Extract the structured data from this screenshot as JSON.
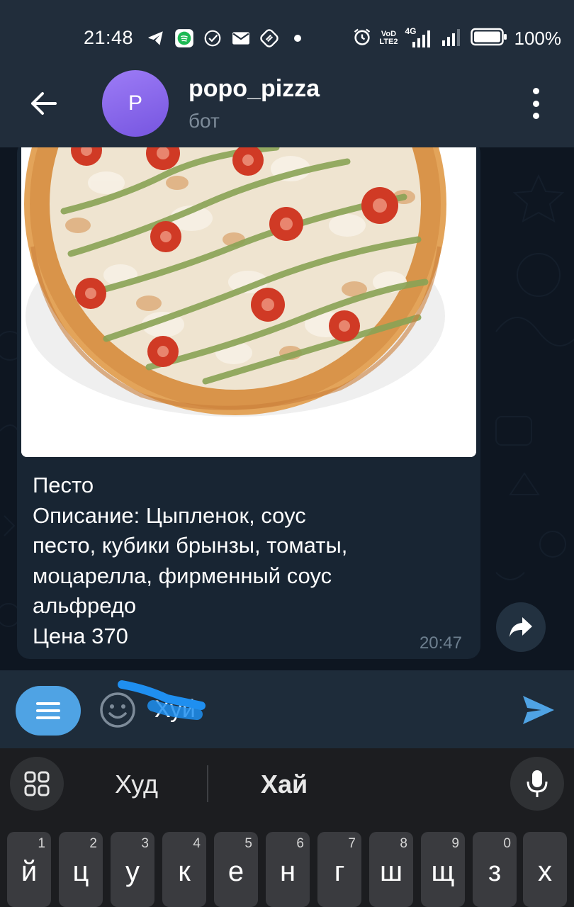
{
  "status_bar": {
    "time": "21:48",
    "net_label_top": "VoD",
    "net_label_bottom": "LTE2",
    "network_type": "4G",
    "battery": "100%"
  },
  "header": {
    "avatar_letter": "P",
    "title": "popo_pizza",
    "subtitle": "бот"
  },
  "message": {
    "lines": [
      "Песто",
      "Описание: Цыпленок, соус",
      "песто, кубики брынзы, томаты,",
      "моцарелла, фирменный соус",
      "альфредо",
      "Цена 370"
    ],
    "time": "20:47"
  },
  "input": {
    "text": "Хуй"
  },
  "keyboard": {
    "suggestions": [
      "Худ",
      "Хай"
    ],
    "keys": [
      {
        "letter": "й",
        "num": "1"
      },
      {
        "letter": "ц",
        "num": "2"
      },
      {
        "letter": "у",
        "num": "3"
      },
      {
        "letter": "к",
        "num": "4"
      },
      {
        "letter": "е",
        "num": "5"
      },
      {
        "letter": "н",
        "num": "6"
      },
      {
        "letter": "г",
        "num": "7"
      },
      {
        "letter": "ш",
        "num": "8"
      },
      {
        "letter": "щ",
        "num": "9"
      },
      {
        "letter": "з",
        "num": "0"
      },
      {
        "letter": "х",
        "num": ""
      }
    ]
  },
  "colors": {
    "header_bg": "#212d3b",
    "chat_bg": "#0e1621",
    "bubble_bg": "#182533",
    "accent": "#4fa3e4",
    "keyboard_bg": "#1c1d20"
  }
}
